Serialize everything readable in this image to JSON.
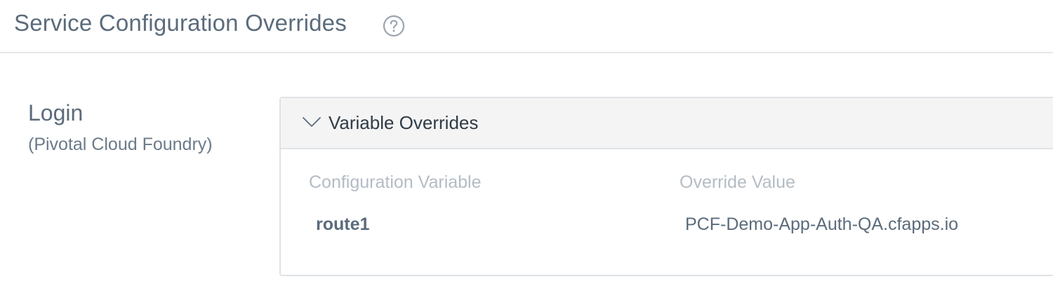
{
  "header": {
    "title": "Service Configuration Overrides",
    "help_icon": "question-circle-icon"
  },
  "service": {
    "name": "Login",
    "type": "(Pivotal Cloud Foundry)"
  },
  "overrides_panel": {
    "title": "Variable Overrides",
    "expanded": true,
    "toggle_icon": "chevron-down-icon",
    "columns": [
      "Configuration Variable",
      "Override Value"
    ],
    "rows": [
      {
        "variable": "route1",
        "value": "PCF-Demo-App-Auth-QA.cfapps.io"
      }
    ]
  },
  "colors": {
    "title_text": "#5b6b7b",
    "column_header_text": "#b4bcc4",
    "panel_header_bg": "#f4f4f4",
    "border": "#dfe2e6"
  }
}
